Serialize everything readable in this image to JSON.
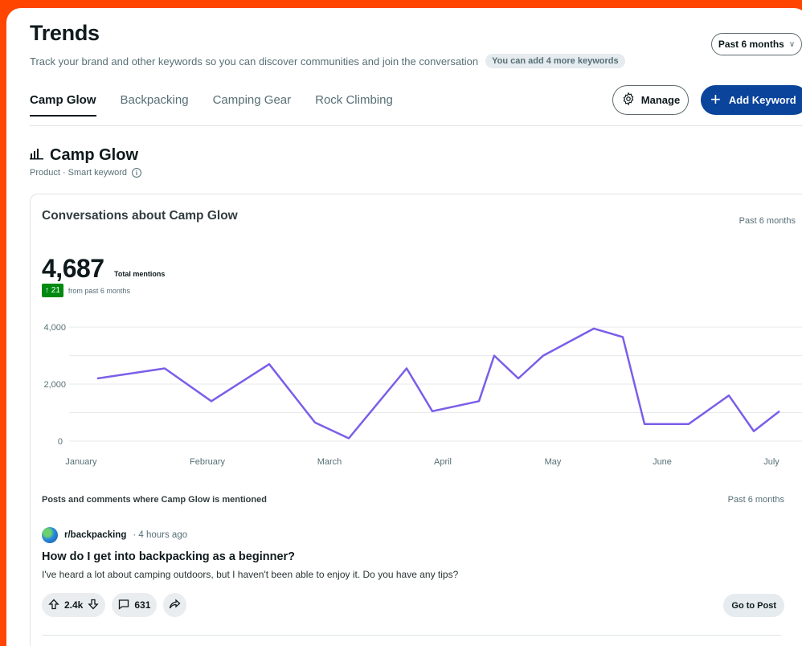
{
  "header": {
    "title": "Trends",
    "subtitle": "Track your brand and other keywords so you can discover communities and join the conversation",
    "keyword_badge": "You can add 4 more keywords",
    "period_selector": "Past 6 months"
  },
  "tabs": [
    {
      "label": "Camp Glow",
      "active": true
    },
    {
      "label": "Backpacking",
      "active": false
    },
    {
      "label": "Camping Gear",
      "active": false
    },
    {
      "label": "Rock Climbing",
      "active": false
    }
  ],
  "toolbar": {
    "manage_label": "Manage",
    "add_keyword_label": "Add Keyword"
  },
  "keyword": {
    "name": "Camp Glow",
    "meta": "Product · Smart keyword"
  },
  "card": {
    "title": "Conversations about Camp Glow",
    "period": "Past 6 months",
    "total": "4,687",
    "total_label": "Total mentions",
    "delta": "21",
    "delta_label": "from past 6 months"
  },
  "chart_data": {
    "type": "line",
    "x": [
      0,
      0.6,
      1.0,
      1.35,
      2.0,
      2.3,
      2.85,
      3.4,
      3.7,
      3.9,
      4.1,
      4.3,
      4.6,
      4.95,
      5.1,
      5.35,
      5.5,
      6.25,
      6.4,
      6.55,
      6.7
    ],
    "values": [
      2200,
      2550,
      1400,
      2700,
      650,
      100,
      2550,
      1050,
      1400,
      3000,
      2200,
      3000,
      3950,
      3650,
      600,
      600,
      1600,
      350,
      1050
    ],
    "xs": [
      0,
      0.6,
      1.0,
      1.35,
      2.0,
      2.3,
      2.85,
      3.2,
      3.4,
      3.5,
      3.7,
      3.9,
      4.1,
      4.3,
      4.6,
      4.95,
      5.1,
      5.35,
      5.5,
      6.25,
      6.4,
      6.55,
      6.7
    ],
    "categories": [
      "January",
      "February",
      "March",
      "April",
      "May",
      "June",
      "July"
    ],
    "ytick_labels": [
      "0",
      "2,000",
      "4,000"
    ],
    "ylim": [
      0,
      4200
    ],
    "line_color": "#7b5ee8",
    "grid": true
  },
  "posts": {
    "heading": "Posts and comments where Camp Glow is mentioned",
    "period": "Past 6 months",
    "items": [
      {
        "subreddit": "r/backpacking",
        "time": "· 4 hours ago",
        "title": "How do I get into backpacking as a beginner?",
        "body": "I've heard a lot about camping outdoors, but I haven't been able to enjoy it. Do you have any tips?",
        "votes": "2.4k",
        "comments": "631",
        "go_label": "Go to Post"
      }
    ]
  },
  "colors": {
    "brand": "#ff4500",
    "primary_button": "#0a449b",
    "positive": "#008a10"
  }
}
